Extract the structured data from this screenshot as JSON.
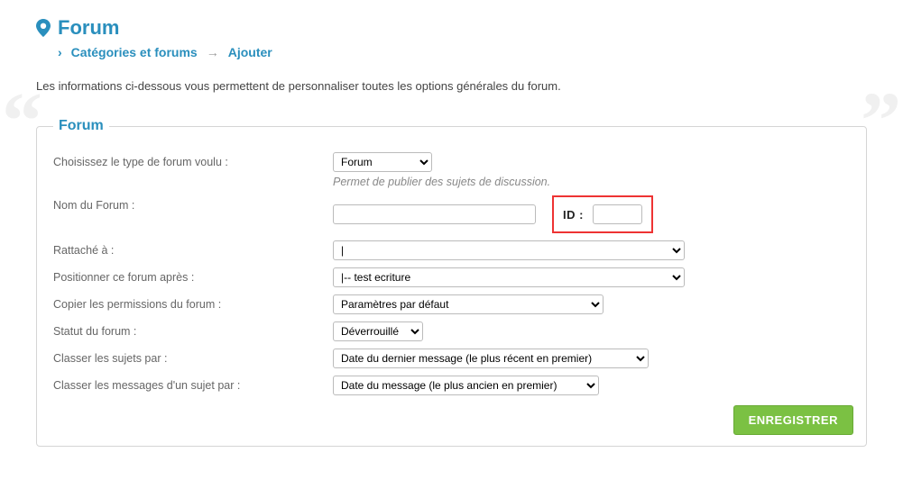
{
  "header": {
    "title": "Forum",
    "breadcrumb": {
      "level1": "Catégories et forums",
      "level2": "Ajouter"
    }
  },
  "intro": "Les informations ci-dessous vous permettent de personnaliser toutes les options générales du forum.",
  "panel": {
    "legend": "Forum",
    "fields": {
      "type": {
        "label": "Choisissez le type de forum voulu :",
        "value": "Forum",
        "hint": "Permet de publier des sujets de discussion."
      },
      "name": {
        "label": "Nom du Forum :",
        "value": "",
        "id_label": "ID :",
        "id_value": ""
      },
      "parent": {
        "label": "Rattaché à :",
        "value": "|"
      },
      "position": {
        "label": "Positionner ce forum après :",
        "value": "|-- test ecriture"
      },
      "permissions": {
        "label": "Copier les permissions du forum :",
        "value": "Paramètres par défaut"
      },
      "status": {
        "label": "Statut du forum :",
        "value": "Déverrouillé"
      },
      "sort_topics": {
        "label": "Classer les sujets par :",
        "value": "Date du dernier message (le plus récent en premier)"
      },
      "sort_posts": {
        "label": "Classer les messages d'un sujet par :",
        "value": "Date du message (le plus ancien en premier)"
      }
    },
    "save_label": "Enregistrer"
  }
}
